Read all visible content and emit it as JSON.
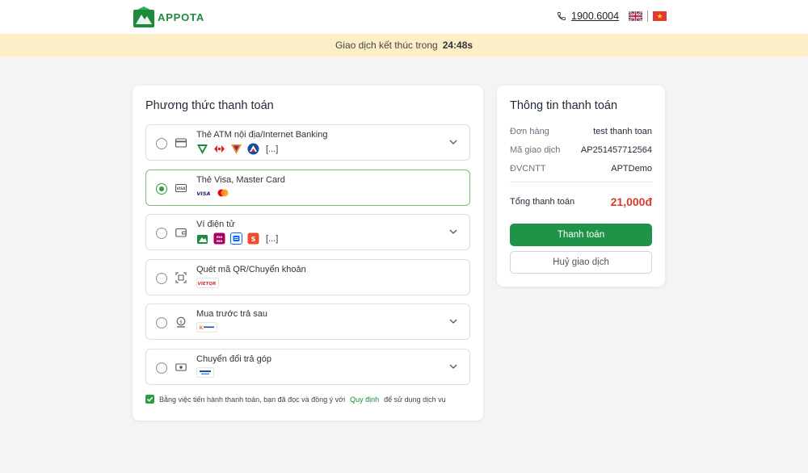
{
  "header": {
    "logo_text": "APPOTA",
    "hotline": "1900.6004"
  },
  "timer": {
    "label": "Giao dịch kết thúc trong",
    "value": "24:48s"
  },
  "methods_card": {
    "title": "Phương thức thanh toán",
    "methods": [
      {
        "label": "Thẻ ATM nội địa/Internet Banking",
        "more": "[...]"
      },
      {
        "label": "Thẻ Visa, Master Card"
      },
      {
        "label": "Ví điện tử",
        "more": "[...]"
      },
      {
        "label": "Quét mã QR/Chuyển khoản"
      },
      {
        "label": "Mua trước trả sau"
      },
      {
        "label": "Chuyển đổi trả góp"
      }
    ],
    "agreement": {
      "prefix": "Bằng việc tiến hành thanh toán, bạn đã đọc và đồng ý với",
      "link": "Quy định",
      "suffix": "để sử dụng dịch vụ"
    }
  },
  "info_card": {
    "title": "Thông tin thanh toán",
    "rows": [
      {
        "key": "Đơn hàng",
        "value": "test thanh toan"
      },
      {
        "key": "Mã giao dịch",
        "value": "AP251457712564"
      },
      {
        "key": "ĐVCNTT",
        "value": "APTDemo"
      }
    ],
    "total_label": "Tổng thanh toán",
    "total_value": "21,000đ",
    "pay_button": "Thanh toán",
    "cancel_button": "Huỷ giao dịch"
  },
  "colors": {
    "brand": "#1f9448",
    "timer_bg": "#fcefc7",
    "total": "#d93a2b"
  }
}
